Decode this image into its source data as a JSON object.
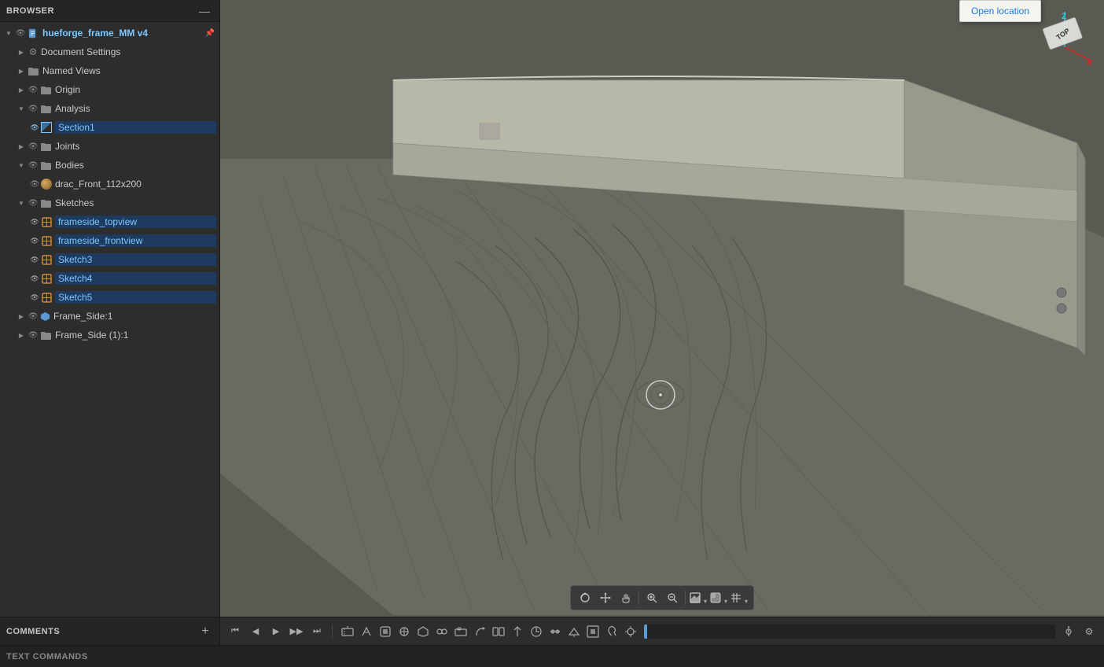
{
  "sidebar": {
    "title": "BROWSER",
    "root_item": {
      "label": "hueforge_frame_MM v4",
      "icon": "document-icon"
    },
    "items": [
      {
        "id": "document-settings",
        "label": "Document Settings",
        "indent": 1,
        "icon": "gear",
        "chevron": "right",
        "eye": false
      },
      {
        "id": "named-views",
        "label": "Named Views",
        "indent": 1,
        "icon": "folder",
        "chevron": "right",
        "eye": false
      },
      {
        "id": "origin",
        "label": "Origin",
        "indent": 1,
        "icon": "folder",
        "chevron": "right",
        "eye": true
      },
      {
        "id": "analysis",
        "label": "Analysis",
        "indent": 1,
        "icon": "folder",
        "chevron": "down",
        "eye": true
      },
      {
        "id": "section1",
        "label": "Section1",
        "indent": 2,
        "icon": "section",
        "chevron": null,
        "eye": true,
        "highlighted": true
      },
      {
        "id": "joints",
        "label": "Joints",
        "indent": 1,
        "icon": "folder",
        "chevron": "right",
        "eye": true
      },
      {
        "id": "bodies",
        "label": "Bodies",
        "indent": 1,
        "icon": "folder",
        "chevron": "down",
        "eye": true
      },
      {
        "id": "drac-front",
        "label": "drac_Front_112x200",
        "indent": 2,
        "icon": "sphere",
        "chevron": null,
        "eye": true
      },
      {
        "id": "sketches",
        "label": "Sketches",
        "indent": 1,
        "icon": "folder",
        "chevron": "down",
        "eye": true
      },
      {
        "id": "frameside-topview",
        "label": "frameside_topview",
        "indent": 2,
        "icon": "sketch",
        "chevron": null,
        "eye": true,
        "highlighted": true
      },
      {
        "id": "frameside-frontview",
        "label": "frameside_frontview",
        "indent": 2,
        "icon": "sketch",
        "chevron": null,
        "eye": true,
        "highlighted": true
      },
      {
        "id": "sketch3",
        "label": "Sketch3",
        "indent": 2,
        "icon": "sketch",
        "chevron": null,
        "eye": true,
        "highlighted": true
      },
      {
        "id": "sketch4",
        "label": "Sketch4",
        "indent": 2,
        "icon": "sketch",
        "chevron": null,
        "eye": true,
        "highlighted": true
      },
      {
        "id": "sketch5",
        "label": "Sketch5",
        "indent": 2,
        "icon": "sketch",
        "chevron": null,
        "eye": true,
        "highlighted": true
      },
      {
        "id": "frame-side-1",
        "label": "Frame_Side:1",
        "indent": 1,
        "icon": "component",
        "chevron": "right",
        "eye": true
      },
      {
        "id": "frame-side-1-1",
        "label": "Frame_Side (1):1",
        "indent": 1,
        "icon": "folder",
        "chevron": "right",
        "eye": true
      }
    ]
  },
  "comments_panel": {
    "title": "COMMENTS",
    "add_icon": "plus-icon"
  },
  "animation_toolbar": {
    "play_back_label": "⏮",
    "prev_label": "⏪",
    "play_label": "▶",
    "next_label": "⏩",
    "play_forward_label": "⏭",
    "tools": [
      "move-joint",
      "animate-joint",
      "contact-set",
      "motion-link",
      "animate-model",
      "record",
      "transform-component",
      "constrain",
      "align",
      "joint-origin",
      "move-copy",
      "point-origin",
      "point-contact",
      "attach-joint",
      "snap-joint",
      "rotate",
      "timeline",
      "keyframe"
    ],
    "settings_label": "⚙"
  },
  "text_commands": {
    "title": "TEXT COMMANDS"
  },
  "viewport": {
    "open_location_label": "Open location",
    "axes": {
      "z": "Z",
      "x": "X",
      "top": "TOP"
    }
  },
  "colors": {
    "sidebar_bg": "#2d2d2d",
    "sidebar_header_bg": "#252525",
    "viewport_bg": "#5a5a52",
    "toolbar_bg": "#3a3a3a",
    "accent_blue": "#1a7adb",
    "highlight_blue": "#1e3a5f"
  }
}
